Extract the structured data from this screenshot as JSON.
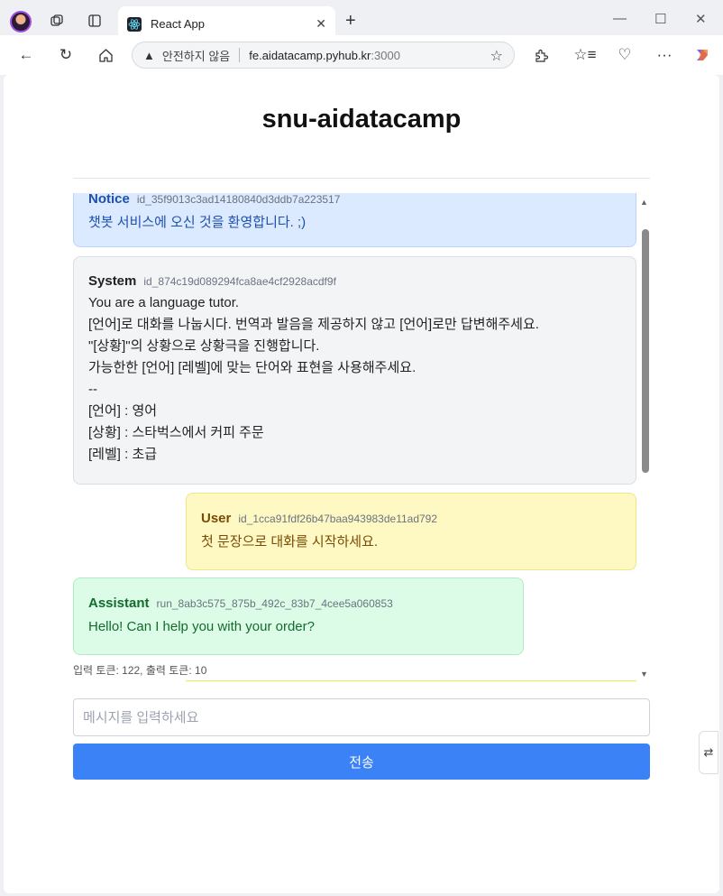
{
  "browser": {
    "tab_title": "React App",
    "address": {
      "security_label": "안전하지 않음",
      "host": "fe.aidatacamp.pyhub.kr",
      "port": ":3000"
    }
  },
  "page": {
    "title": "snu-aidatacamp"
  },
  "messages": {
    "notice": {
      "role": "Notice",
      "id": "id_35f9013c3ad14180840d3ddb7a223517",
      "text": "챗봇 서비스에 오신 것을 환영합니다. ;)"
    },
    "system": {
      "role": "System",
      "id": "id_874c19d089294fca8ae4cf2928acdf9f",
      "lines": [
        "You are a language tutor.",
        "[언어]로 대화를 나눕시다. 번역과 발음을 제공하지 않고 [언어]로만 답변해주세요.",
        "\"[상황]\"의 상황으로 상황극을 진행합니다.",
        "가능한한 [언어] [레벨]에 맞는 단어와 표현을 사용해주세요.",
        "--",
        "[언어] : 영어",
        "[상황] : 스타벅스에서 커피 주문",
        "[레벨] : 초급"
      ]
    },
    "user": {
      "role": "User",
      "id": "id_1cca91fdf26b47baa943983de11ad792",
      "text": "첫 문장으로 대화를 시작하세요."
    },
    "assistant": {
      "role": "Assistant",
      "id": "run_8ab3c575_875b_492c_83b7_4cee5a060853",
      "text": "Hello! Can I help you with your order?"
    },
    "token_usage": "입력 토큰: 122, 출력 토큰: 10"
  },
  "composer": {
    "placeholder": "메시지를 입력하세요",
    "send_label": "전송"
  },
  "icons": [
    "profile-avatar",
    "workspaces-icon",
    "tab-actions-icon",
    "react-icon",
    "close-icon",
    "plus-icon",
    "minimize-icon",
    "maximize-icon",
    "back-icon",
    "refresh-icon",
    "home-icon",
    "warning-icon",
    "star-icon",
    "extensions-icon",
    "favorites-icon",
    "browser-essentials-icon",
    "more-icon",
    "copilot-icon"
  ]
}
